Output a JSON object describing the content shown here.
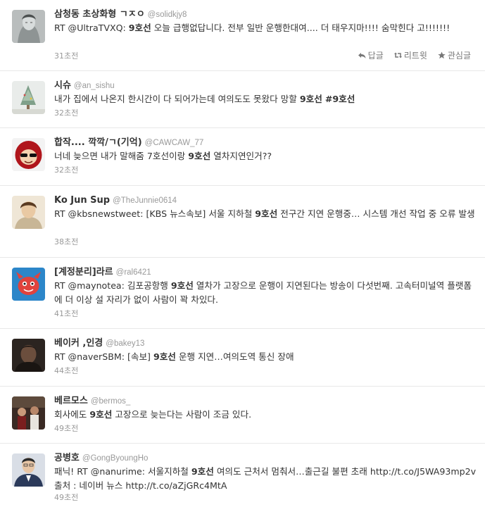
{
  "tweets": [
    {
      "name": "삼청동 초상화형 ㄱㅈㅇ",
      "handle": "@solidkjy8",
      "text1": "RT @UltraTVXQ: ",
      "bold1": "9호선",
      "text2": " 오늘 급행없답니다. 전부 일반 운행한대여.... 더 태우지마!!!! 숨막힌다 고!!!!!!!",
      "time": "31초전"
    },
    {
      "name": "시슈",
      "handle": "@an_sishu",
      "text1": "내가 집에서 나온지 한시간이 다 되어가는데 여의도도 못왔다 망할 ",
      "bold1": "9호선",
      "bold2": "#9호선",
      "time": "32초전"
    },
    {
      "name": "합작.... 깍깍/ㄱ(기억)",
      "handle": "@CAWCAW_77",
      "text1": "너네 늦으면 내가 말해줌 7호선이랑 ",
      "bold1": "9호선",
      "text2": " 열차지연인거??",
      "time": "32초전"
    },
    {
      "name": "Ko Jun Sup",
      "handle": "@TheJunnie0614",
      "rt": "RT ",
      "mention": "@kbsnewstweet",
      "text1": ": [KBS 뉴스속보] 서울 지하철 ",
      "bold1": "9호선",
      "text2": " 전구간 지연 운행중… 시스템 개선 작업 중 오류 발생",
      "time": "38초전"
    },
    {
      "name": "[계정분리]라르",
      "handle": "@ral6421",
      "rt": "RT ",
      "mention": "@maynotea",
      "text1": ": 김포공항행 ",
      "bold1": "9호선",
      "text2": " 열차가 고장으로 운행이 지연된다는 방송이 다섯번째. 고속터미널역 플랫폼에 더 이상 설 자리가 없이 사람이 꽉 차있다.",
      "time": "41초전"
    },
    {
      "name": "베이커 ,인경",
      "handle": "@bakey13",
      "rt": "RT ",
      "mention": "@naverSBM",
      "text1": ": [속보] ",
      "bold1": "9호선",
      "text2": " 운행 지연…여의도역 통신 장애",
      "time": "44초전"
    },
    {
      "name": "베르모스",
      "handle": "@bermos_",
      "text1": "회사에도 ",
      "bold1": "9호선",
      "text2": " 고장으로 늦는다는 사람이 조금 있다.",
      "time": "49초전"
    },
    {
      "name": "공병호",
      "handle": "@GongByoungHo",
      "text1": "패닉! RT ",
      "mention": "@nanurime",
      "text2": ": 서울지하철 ",
      "bold1": "9호선",
      "text3": " 여의도 근처서 멈춰서…출근길 불편 초래 ",
      "link1": "http://t.co/J5WA93mp2v",
      "text4": " 출처 : 네이버 뉴스 ",
      "link2": "http://t.co/aZjGRc4MtA",
      "time": "49초전"
    }
  ],
  "actions": {
    "reply": "답글",
    "retweet": "리트윗",
    "favorite": "관심글"
  },
  "colors": {
    "name": "#333333",
    "meta": "#999999",
    "border": "#e8e8e8"
  }
}
